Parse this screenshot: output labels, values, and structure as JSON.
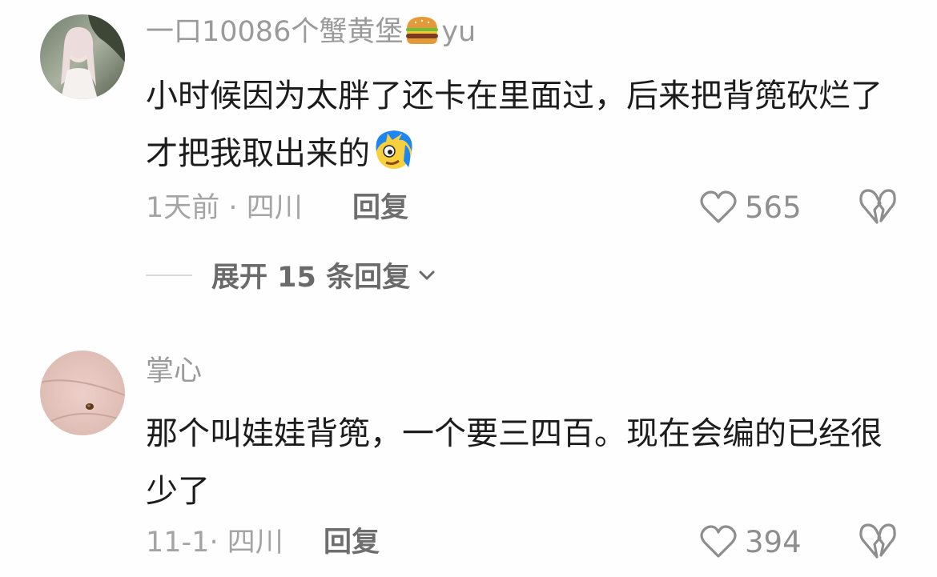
{
  "comments": [
    {
      "username_prefix": "一口10086个蟹黄堡",
      "username_suffix": "yu",
      "username_emoji": "hamburger-emoji",
      "text_part1": "小时候因为太胖了还卡在里面过，后来把背篼砍烂了才把我取出来的",
      "text_emoji": "blue-hair-face-emoji",
      "time": "1天前",
      "location": "四川",
      "time_location_separator": "·",
      "reply_label": "回复",
      "likes": "565",
      "expand_label": "展开 15 条回复"
    },
    {
      "username_prefix": "掌心",
      "text_part1": "那个叫娃娃背篼，一个要三四百。现在会编的已经很少了",
      "time": "11-1",
      "location": "四川",
      "time_location_separator": "·",
      "reply_label": "回复",
      "likes": "394"
    }
  ],
  "icons": {
    "like": "heart-outline-icon",
    "dislike": "broken-heart-icon",
    "expand": "chevron-down-icon"
  },
  "colors": {
    "username": "#9a9a9a",
    "text": "#1c1c1c",
    "meta": "#a4a4a4",
    "icon": "#8e8e8e"
  }
}
